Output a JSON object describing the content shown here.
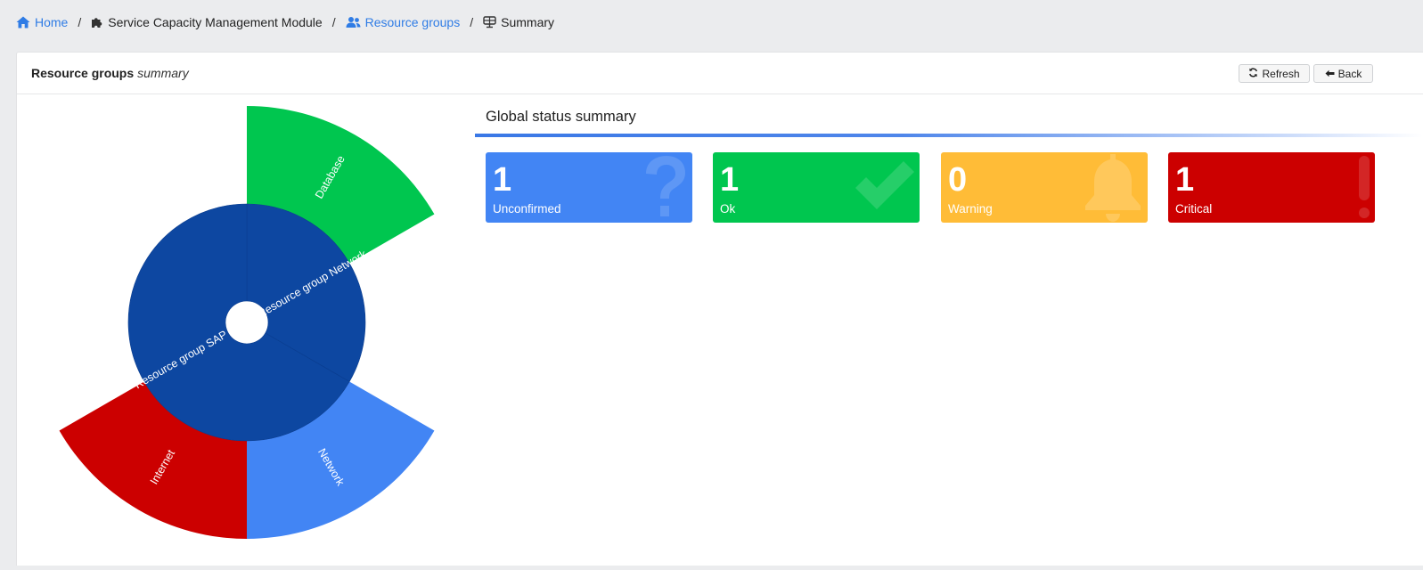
{
  "breadcrumb": {
    "home": "Home",
    "module": "Service Capacity Management Module",
    "resource_groups": "Resource groups",
    "summary": "Summary",
    "separator": "/"
  },
  "panel": {
    "title_strong": "Resource groups",
    "title_em": "summary",
    "refresh_label": "Refresh",
    "back_label": "Back"
  },
  "global_status": {
    "title": "Global status summary"
  },
  "status_cards": [
    {
      "count": "1",
      "label": "Unconfirmed",
      "color": "#4285f4",
      "icon": "question-icon"
    },
    {
      "count": "1",
      "label": "Ok",
      "color": "#00c64f",
      "icon": "check-icon"
    },
    {
      "count": "0",
      "label": "Warning",
      "color": "#ffbc37",
      "icon": "bell-icon"
    },
    {
      "count": "1",
      "label": "Critical",
      "color": "#cc0000",
      "icon": "exclamation-icon"
    }
  ],
  "colors": {
    "link": "#2f7ce5",
    "inner_ring": "#0d47a1",
    "unconfirmed": "#4285f4",
    "ok": "#00c64f",
    "warning": "#ffbc37",
    "critical": "#cc0000"
  },
  "chart_data": {
    "type": "sunburst",
    "inner": [
      {
        "name": "Resource group Network",
        "start_deg": 0,
        "end_deg": 120,
        "color": "#0d47a1"
      },
      {
        "name": "Resource group SAP",
        "start_deg": 120,
        "end_deg": 360,
        "color": "#0d47a1"
      }
    ],
    "outer": [
      {
        "name": "Database",
        "start_deg": 0,
        "end_deg": 60,
        "color": "#00c64f"
      },
      {
        "name": "Network",
        "start_deg": 120,
        "end_deg": 180,
        "color": "#4285f4"
      },
      {
        "name": "Internet",
        "start_deg": 180,
        "end_deg": 240,
        "color": "#cc0000"
      }
    ]
  }
}
